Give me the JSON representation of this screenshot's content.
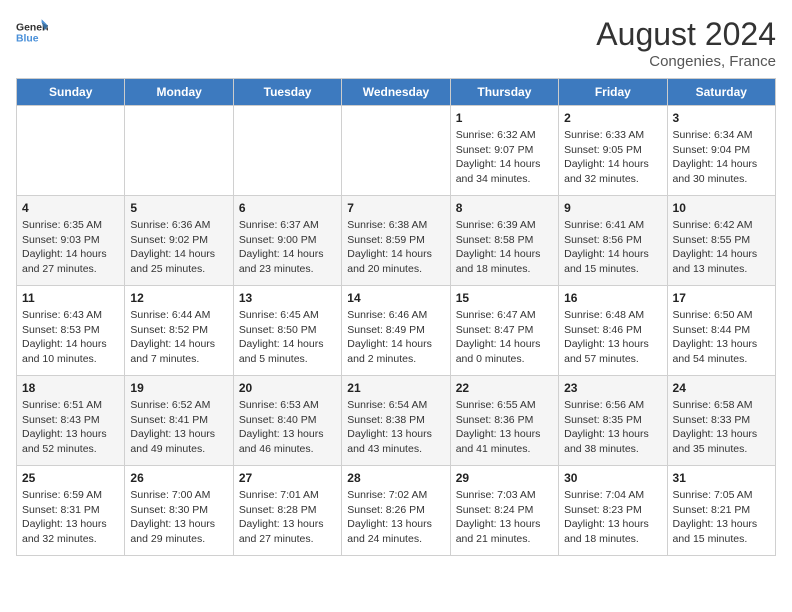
{
  "header": {
    "logo_line1": "General",
    "logo_line2": "Blue",
    "month_year": "August 2024",
    "location": "Congenies, France"
  },
  "days_of_week": [
    "Sunday",
    "Monday",
    "Tuesday",
    "Wednesday",
    "Thursday",
    "Friday",
    "Saturday"
  ],
  "weeks": [
    [
      {
        "day": "",
        "info": ""
      },
      {
        "day": "",
        "info": ""
      },
      {
        "day": "",
        "info": ""
      },
      {
        "day": "",
        "info": ""
      },
      {
        "day": "1",
        "info": "Sunrise: 6:32 AM\nSunset: 9:07 PM\nDaylight: 14 hours and 34 minutes."
      },
      {
        "day": "2",
        "info": "Sunrise: 6:33 AM\nSunset: 9:05 PM\nDaylight: 14 hours and 32 minutes."
      },
      {
        "day": "3",
        "info": "Sunrise: 6:34 AM\nSunset: 9:04 PM\nDaylight: 14 hours and 30 minutes."
      }
    ],
    [
      {
        "day": "4",
        "info": "Sunrise: 6:35 AM\nSunset: 9:03 PM\nDaylight: 14 hours and 27 minutes."
      },
      {
        "day": "5",
        "info": "Sunrise: 6:36 AM\nSunset: 9:02 PM\nDaylight: 14 hours and 25 minutes."
      },
      {
        "day": "6",
        "info": "Sunrise: 6:37 AM\nSunset: 9:00 PM\nDaylight: 14 hours and 23 minutes."
      },
      {
        "day": "7",
        "info": "Sunrise: 6:38 AM\nSunset: 8:59 PM\nDaylight: 14 hours and 20 minutes."
      },
      {
        "day": "8",
        "info": "Sunrise: 6:39 AM\nSunset: 8:58 PM\nDaylight: 14 hours and 18 minutes."
      },
      {
        "day": "9",
        "info": "Sunrise: 6:41 AM\nSunset: 8:56 PM\nDaylight: 14 hours and 15 minutes."
      },
      {
        "day": "10",
        "info": "Sunrise: 6:42 AM\nSunset: 8:55 PM\nDaylight: 14 hours and 13 minutes."
      }
    ],
    [
      {
        "day": "11",
        "info": "Sunrise: 6:43 AM\nSunset: 8:53 PM\nDaylight: 14 hours and 10 minutes."
      },
      {
        "day": "12",
        "info": "Sunrise: 6:44 AM\nSunset: 8:52 PM\nDaylight: 14 hours and 7 minutes."
      },
      {
        "day": "13",
        "info": "Sunrise: 6:45 AM\nSunset: 8:50 PM\nDaylight: 14 hours and 5 minutes."
      },
      {
        "day": "14",
        "info": "Sunrise: 6:46 AM\nSunset: 8:49 PM\nDaylight: 14 hours and 2 minutes."
      },
      {
        "day": "15",
        "info": "Sunrise: 6:47 AM\nSunset: 8:47 PM\nDaylight: 14 hours and 0 minutes."
      },
      {
        "day": "16",
        "info": "Sunrise: 6:48 AM\nSunset: 8:46 PM\nDaylight: 13 hours and 57 minutes."
      },
      {
        "day": "17",
        "info": "Sunrise: 6:50 AM\nSunset: 8:44 PM\nDaylight: 13 hours and 54 minutes."
      }
    ],
    [
      {
        "day": "18",
        "info": "Sunrise: 6:51 AM\nSunset: 8:43 PM\nDaylight: 13 hours and 52 minutes."
      },
      {
        "day": "19",
        "info": "Sunrise: 6:52 AM\nSunset: 8:41 PM\nDaylight: 13 hours and 49 minutes."
      },
      {
        "day": "20",
        "info": "Sunrise: 6:53 AM\nSunset: 8:40 PM\nDaylight: 13 hours and 46 minutes."
      },
      {
        "day": "21",
        "info": "Sunrise: 6:54 AM\nSunset: 8:38 PM\nDaylight: 13 hours and 43 minutes."
      },
      {
        "day": "22",
        "info": "Sunrise: 6:55 AM\nSunset: 8:36 PM\nDaylight: 13 hours and 41 minutes."
      },
      {
        "day": "23",
        "info": "Sunrise: 6:56 AM\nSunset: 8:35 PM\nDaylight: 13 hours and 38 minutes."
      },
      {
        "day": "24",
        "info": "Sunrise: 6:58 AM\nSunset: 8:33 PM\nDaylight: 13 hours and 35 minutes."
      }
    ],
    [
      {
        "day": "25",
        "info": "Sunrise: 6:59 AM\nSunset: 8:31 PM\nDaylight: 13 hours and 32 minutes."
      },
      {
        "day": "26",
        "info": "Sunrise: 7:00 AM\nSunset: 8:30 PM\nDaylight: 13 hours and 29 minutes."
      },
      {
        "day": "27",
        "info": "Sunrise: 7:01 AM\nSunset: 8:28 PM\nDaylight: 13 hours and 27 minutes."
      },
      {
        "day": "28",
        "info": "Sunrise: 7:02 AM\nSunset: 8:26 PM\nDaylight: 13 hours and 24 minutes."
      },
      {
        "day": "29",
        "info": "Sunrise: 7:03 AM\nSunset: 8:24 PM\nDaylight: 13 hours and 21 minutes."
      },
      {
        "day": "30",
        "info": "Sunrise: 7:04 AM\nSunset: 8:23 PM\nDaylight: 13 hours and 18 minutes."
      },
      {
        "day": "31",
        "info": "Sunrise: 7:05 AM\nSunset: 8:21 PM\nDaylight: 13 hours and 15 minutes."
      }
    ]
  ]
}
